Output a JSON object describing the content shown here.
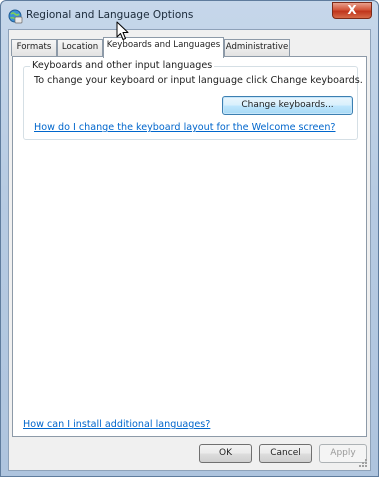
{
  "window": {
    "title": "Regional and Language Options",
    "close_label": "X"
  },
  "tabs": [
    {
      "label": "Formats",
      "active": false
    },
    {
      "label": "Location",
      "active": false
    },
    {
      "label": "Keyboards and Languages",
      "active": true
    },
    {
      "label": "Administrative",
      "active": false
    }
  ],
  "keyboards_group": {
    "title": "Keyboards and other input languages",
    "description": "To change your keyboard or input language click Change keyboards.",
    "change_button": "Change keyboards...",
    "welcome_link": "How do I change the keyboard layout for the Welcome screen?"
  },
  "install_link": "How can I install additional languages?",
  "footer": {
    "ok": "OK",
    "cancel": "Cancel",
    "apply": "Apply"
  },
  "icons": {
    "app": "globe-keyboard-icon",
    "cursor": "mouse-pointer-icon"
  },
  "colors": {
    "link": "#0066cc",
    "close_button": "#c0351c",
    "frame": "#b7cbe2"
  }
}
